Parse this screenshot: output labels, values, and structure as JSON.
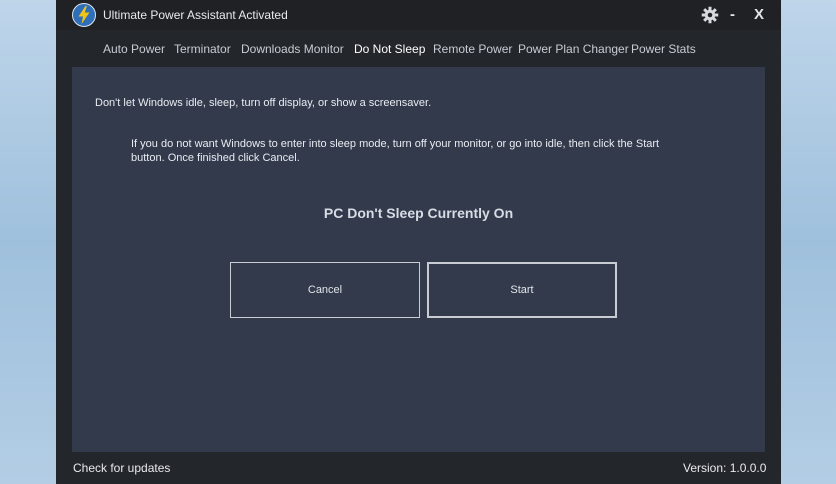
{
  "app": {
    "title": "Ultimate Power Assistant Activated"
  },
  "nav": {
    "items": [
      {
        "label": "Auto Power"
      },
      {
        "label": "Terminator"
      },
      {
        "label": "Downloads Monitor"
      },
      {
        "label": "Do Not Sleep"
      },
      {
        "label": "Remote Power"
      },
      {
        "label": "Power Plan Changer"
      },
      {
        "label": "Power Stats"
      }
    ],
    "active": "Do Not Sleep"
  },
  "main": {
    "description": "Don't let Windows idle, sleep, turn off display, or show a screensaver.",
    "instructions": "If you do not want Windows to enter into sleep mode, turn off your monitor, or go into idle, then click the Start button. Once finished click Cancel.",
    "status": "PC Don't Sleep Currently On",
    "cancel_label": "Cancel",
    "start_label": "Start"
  },
  "window_controls": {
    "minimize": "-",
    "close": "X"
  },
  "footer": {
    "check_updates": "Check for updates",
    "version": "Version: 1.0.0.0"
  },
  "colors": {
    "accent": "#f2c417",
    "logo_bg": "#2f6fb7",
    "panel": "#323a4b",
    "window": "#23262b"
  },
  "icons": {
    "logo": "lightning-bolt-icon",
    "settings": "gear-icon"
  }
}
